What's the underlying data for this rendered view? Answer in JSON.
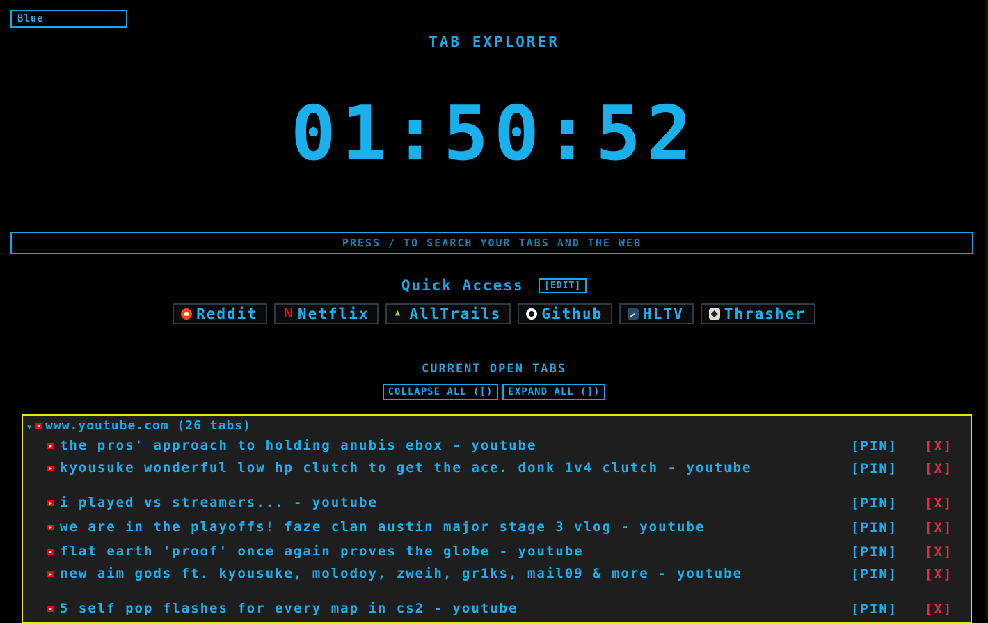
{
  "theme": {
    "selected": "Blue"
  },
  "app_title": "TAB EXPLORER",
  "clock": "01:50:52",
  "search": {
    "placeholder": "PRESS / TO SEARCH YOUR TABS AND THE WEB"
  },
  "quick_access": {
    "title": "Quick Access",
    "edit_label": "[EDIT]",
    "links": [
      {
        "label": "Reddit",
        "icon": "reddit-icon"
      },
      {
        "label": "Netflix",
        "icon": "netflix-icon"
      },
      {
        "label": "AllTrails",
        "icon": "alltrails-icon"
      },
      {
        "label": "Github",
        "icon": "github-icon"
      },
      {
        "label": "HLTV",
        "icon": "hltv-icon"
      },
      {
        "label": "Thrasher",
        "icon": "thrasher-icon"
      }
    ]
  },
  "open_tabs": {
    "title": "CURRENT OPEN TABS",
    "collapse_label": "COLLAPSE ALL ([)",
    "expand_label": "EXPAND ALL (])",
    "group": {
      "label": "www.youtube.com (26 tabs)",
      "pin_label": "[PIN]",
      "close_label": "[X]",
      "tabs": [
        "the pros' approach to holding anubis ebox - youtube",
        "kyousuke wonderful low hp clutch to get the ace. donk 1v4 clutch - youtube",
        "i played vs streamers... - youtube",
        "we are in the playoffs! faze clan austin major stage 3 vlog - youtube",
        "flat earth 'proof' once again proves the globe - youtube",
        "new aim gods ft. kyousuke, molodoy, zweih, gr1ks, mail09 & more - youtube",
        "5 self pop flashes for every map in cs2 - youtube"
      ]
    }
  },
  "colors": {
    "accent": "#1aa7e6",
    "group_border": "#e6e60a",
    "close": "#e6284a",
    "background": "#000000"
  }
}
